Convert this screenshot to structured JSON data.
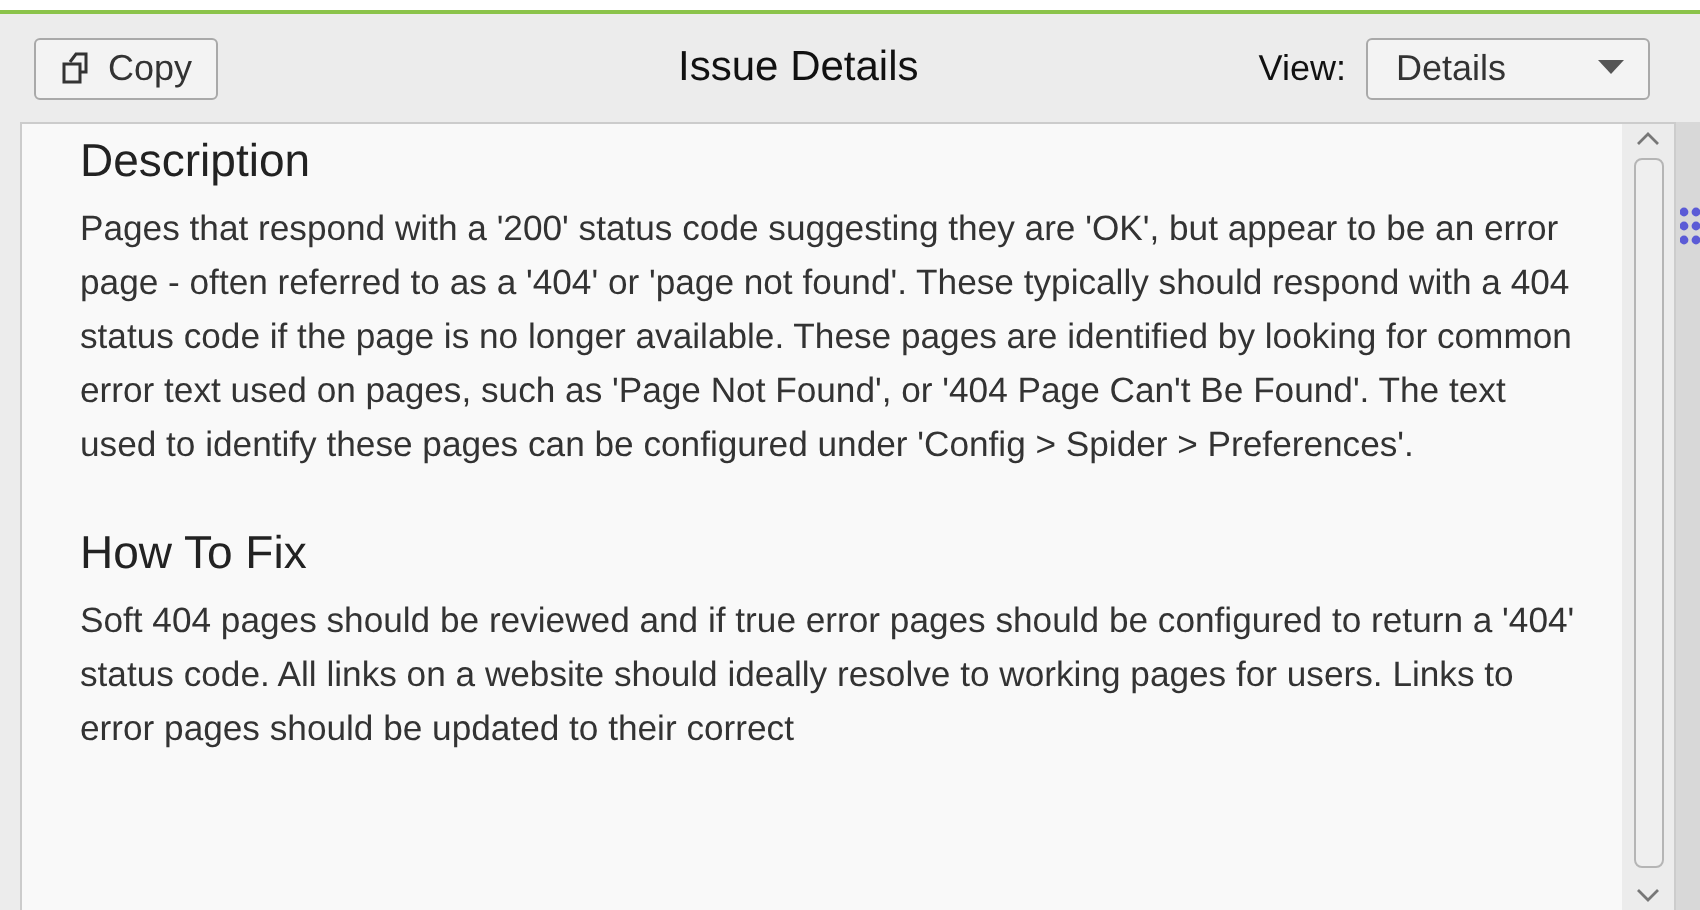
{
  "toolbar": {
    "copy_button": "Copy",
    "title": "Issue Details",
    "view_label": "View:",
    "view_select": "Details"
  },
  "sections": [
    {
      "heading": "Description",
      "text": "Pages that respond with a '200' status code suggesting they are 'OK', but appear to be an error page - often referred to as a '404' or 'page not found'. These typically should respond with a 404 status code if the page is no longer available. These pages are identified by looking for common error text used on pages, such as 'Page Not Found', or '404 Page Can't Be Found'. The text used to identify these pages can be configured under 'Config > Spider > Preferences'."
    },
    {
      "heading": "How To Fix",
      "text": "Soft 404 pages should be reviewed and if true error pages should be configured to return a '404' status code. All links on a website should ideally resolve to working pages for users. Links to error pages should be updated to their correct"
    }
  ]
}
